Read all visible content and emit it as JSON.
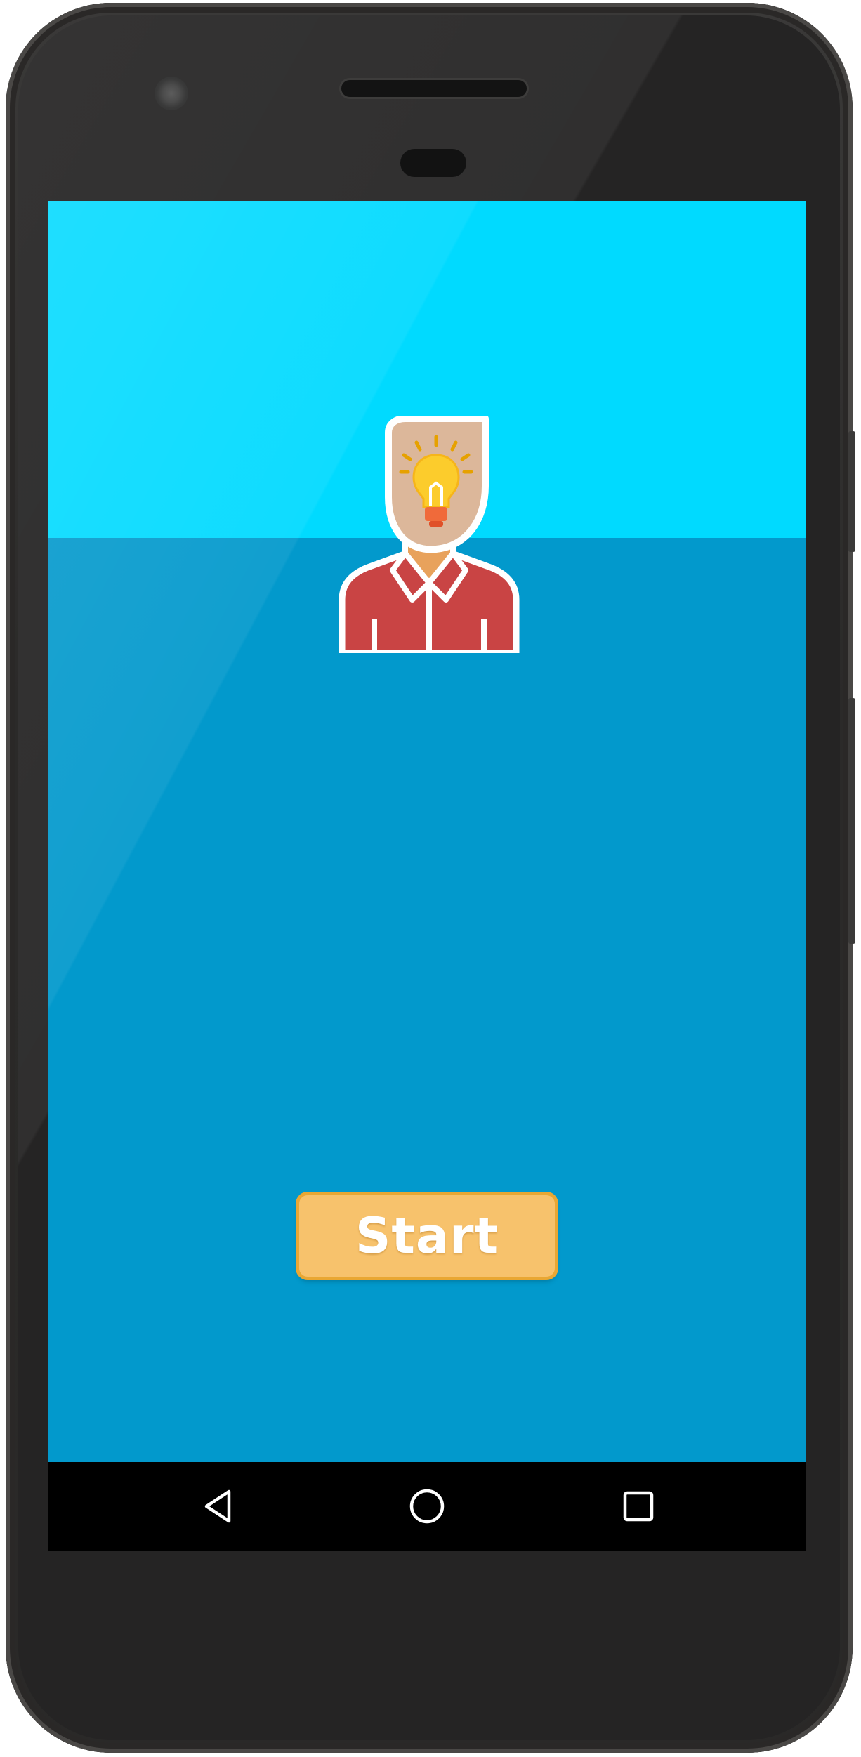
{
  "app": {
    "start_label": "Start",
    "header_color": "#00daff",
    "background_color": "#0299cc",
    "button_color": "#f7c26c",
    "avatar_icon": "person-lightbulb-icon"
  },
  "nav": {
    "back_icon": "back-triangle-icon",
    "home_icon": "home-circle-icon",
    "recents_icon": "recents-square-icon"
  }
}
